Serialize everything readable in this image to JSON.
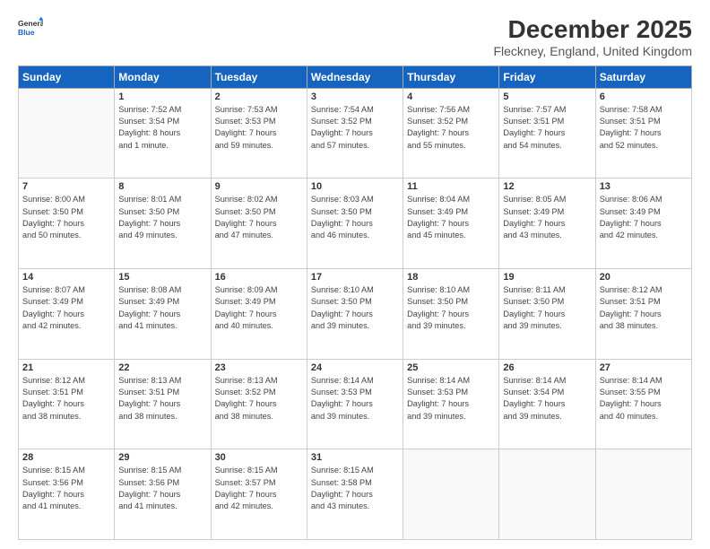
{
  "logo": {
    "line1": "General",
    "line2": "Blue"
  },
  "title": "December 2025",
  "subtitle": "Fleckney, England, United Kingdom",
  "days_header": [
    "Sunday",
    "Monday",
    "Tuesday",
    "Wednesday",
    "Thursday",
    "Friday",
    "Saturday"
  ],
  "weeks": [
    [
      {
        "day": "",
        "info": ""
      },
      {
        "day": "1",
        "info": "Sunrise: 7:52 AM\nSunset: 3:54 PM\nDaylight: 8 hours\nand 1 minute."
      },
      {
        "day": "2",
        "info": "Sunrise: 7:53 AM\nSunset: 3:53 PM\nDaylight: 7 hours\nand 59 minutes."
      },
      {
        "day": "3",
        "info": "Sunrise: 7:54 AM\nSunset: 3:52 PM\nDaylight: 7 hours\nand 57 minutes."
      },
      {
        "day": "4",
        "info": "Sunrise: 7:56 AM\nSunset: 3:52 PM\nDaylight: 7 hours\nand 55 minutes."
      },
      {
        "day": "5",
        "info": "Sunrise: 7:57 AM\nSunset: 3:51 PM\nDaylight: 7 hours\nand 54 minutes."
      },
      {
        "day": "6",
        "info": "Sunrise: 7:58 AM\nSunset: 3:51 PM\nDaylight: 7 hours\nand 52 minutes."
      }
    ],
    [
      {
        "day": "7",
        "info": "Sunrise: 8:00 AM\nSunset: 3:50 PM\nDaylight: 7 hours\nand 50 minutes."
      },
      {
        "day": "8",
        "info": "Sunrise: 8:01 AM\nSunset: 3:50 PM\nDaylight: 7 hours\nand 49 minutes."
      },
      {
        "day": "9",
        "info": "Sunrise: 8:02 AM\nSunset: 3:50 PM\nDaylight: 7 hours\nand 47 minutes."
      },
      {
        "day": "10",
        "info": "Sunrise: 8:03 AM\nSunset: 3:50 PM\nDaylight: 7 hours\nand 46 minutes."
      },
      {
        "day": "11",
        "info": "Sunrise: 8:04 AM\nSunset: 3:49 PM\nDaylight: 7 hours\nand 45 minutes."
      },
      {
        "day": "12",
        "info": "Sunrise: 8:05 AM\nSunset: 3:49 PM\nDaylight: 7 hours\nand 43 minutes."
      },
      {
        "day": "13",
        "info": "Sunrise: 8:06 AM\nSunset: 3:49 PM\nDaylight: 7 hours\nand 42 minutes."
      }
    ],
    [
      {
        "day": "14",
        "info": "Sunrise: 8:07 AM\nSunset: 3:49 PM\nDaylight: 7 hours\nand 42 minutes."
      },
      {
        "day": "15",
        "info": "Sunrise: 8:08 AM\nSunset: 3:49 PM\nDaylight: 7 hours\nand 41 minutes."
      },
      {
        "day": "16",
        "info": "Sunrise: 8:09 AM\nSunset: 3:49 PM\nDaylight: 7 hours\nand 40 minutes."
      },
      {
        "day": "17",
        "info": "Sunrise: 8:10 AM\nSunset: 3:50 PM\nDaylight: 7 hours\nand 39 minutes."
      },
      {
        "day": "18",
        "info": "Sunrise: 8:10 AM\nSunset: 3:50 PM\nDaylight: 7 hours\nand 39 minutes."
      },
      {
        "day": "19",
        "info": "Sunrise: 8:11 AM\nSunset: 3:50 PM\nDaylight: 7 hours\nand 39 minutes."
      },
      {
        "day": "20",
        "info": "Sunrise: 8:12 AM\nSunset: 3:51 PM\nDaylight: 7 hours\nand 38 minutes."
      }
    ],
    [
      {
        "day": "21",
        "info": "Sunrise: 8:12 AM\nSunset: 3:51 PM\nDaylight: 7 hours\nand 38 minutes."
      },
      {
        "day": "22",
        "info": "Sunrise: 8:13 AM\nSunset: 3:51 PM\nDaylight: 7 hours\nand 38 minutes."
      },
      {
        "day": "23",
        "info": "Sunrise: 8:13 AM\nSunset: 3:52 PM\nDaylight: 7 hours\nand 38 minutes."
      },
      {
        "day": "24",
        "info": "Sunrise: 8:14 AM\nSunset: 3:53 PM\nDaylight: 7 hours\nand 39 minutes."
      },
      {
        "day": "25",
        "info": "Sunrise: 8:14 AM\nSunset: 3:53 PM\nDaylight: 7 hours\nand 39 minutes."
      },
      {
        "day": "26",
        "info": "Sunrise: 8:14 AM\nSunset: 3:54 PM\nDaylight: 7 hours\nand 39 minutes."
      },
      {
        "day": "27",
        "info": "Sunrise: 8:14 AM\nSunset: 3:55 PM\nDaylight: 7 hours\nand 40 minutes."
      }
    ],
    [
      {
        "day": "28",
        "info": "Sunrise: 8:15 AM\nSunset: 3:56 PM\nDaylight: 7 hours\nand 41 minutes."
      },
      {
        "day": "29",
        "info": "Sunrise: 8:15 AM\nSunset: 3:56 PM\nDaylight: 7 hours\nand 41 minutes."
      },
      {
        "day": "30",
        "info": "Sunrise: 8:15 AM\nSunset: 3:57 PM\nDaylight: 7 hours\nand 42 minutes."
      },
      {
        "day": "31",
        "info": "Sunrise: 8:15 AM\nSunset: 3:58 PM\nDaylight: 7 hours\nand 43 minutes."
      },
      {
        "day": "",
        "info": ""
      },
      {
        "day": "",
        "info": ""
      },
      {
        "day": "",
        "info": ""
      }
    ]
  ]
}
